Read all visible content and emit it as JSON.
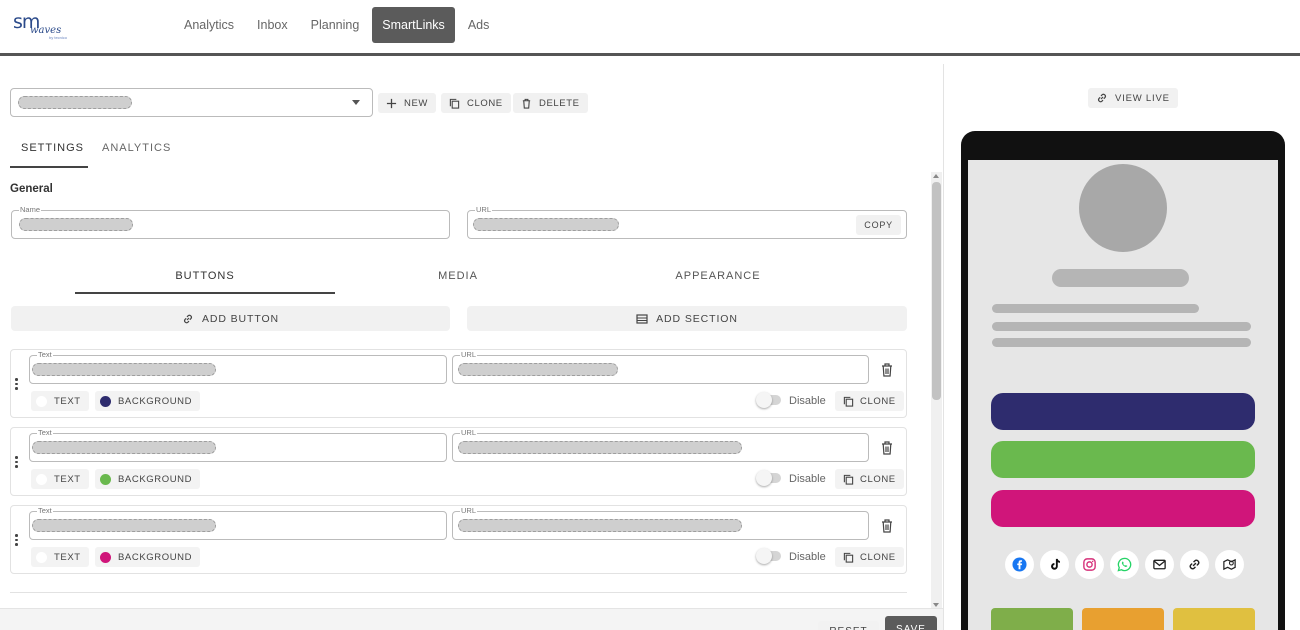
{
  "app": {
    "logo": {
      "primary": "sm",
      "secondary": "waves",
      "tagline": "by tecnico"
    },
    "nav": [
      {
        "label": "Analytics",
        "active": false
      },
      {
        "label": "Inbox",
        "active": false
      },
      {
        "label": "Planning",
        "active": false
      },
      {
        "label": "SmartLinks",
        "active": true
      },
      {
        "label": "Ads",
        "active": false
      }
    ]
  },
  "toolbar": {
    "new_label": "NEW",
    "clone_label": "CLONE",
    "delete_label": "DELETE"
  },
  "tabs": [
    {
      "label": "SETTINGS",
      "active": true
    },
    {
      "label": "ANALYTICS",
      "active": false
    }
  ],
  "general": {
    "title": "General",
    "name_label": "Name",
    "url_label": "URL",
    "copy_label": "COPY"
  },
  "subtabs": [
    {
      "label": "BUTTONS",
      "active": true
    },
    {
      "label": "MEDIA",
      "active": false
    },
    {
      "label": "APPEARANCE",
      "active": false
    }
  ],
  "actions": {
    "add_button_label": "ADD BUTTON",
    "add_section_label": "ADD SECTION"
  },
  "buttons": [
    {
      "text_label": "Text",
      "url_label": "URL",
      "text_chip": "TEXT",
      "bg_chip": "BACKGROUND",
      "bg_color": "#2e2c6e",
      "disable_label": "Disable",
      "clone_label": "CLONE"
    },
    {
      "text_label": "Text",
      "url_label": "URL",
      "text_chip": "TEXT",
      "bg_chip": "BACKGROUND",
      "bg_color": "#6ab94e",
      "disable_label": "Disable",
      "clone_label": "CLONE"
    },
    {
      "text_label": "Text",
      "url_label": "URL",
      "text_chip": "TEXT",
      "bg_chip": "BACKGROUND",
      "bg_color": "#d0157a",
      "disable_label": "Disable",
      "clone_label": "CLONE"
    }
  ],
  "footer": {
    "reset_label": "RESET",
    "save_label": "SAVE"
  },
  "preview": {
    "view_live_label": "VIEW LIVE",
    "button_colors": [
      "#2e2c6e",
      "#6ab94e",
      "#d0157a"
    ],
    "socials": [
      "facebook-icon",
      "tiktok-icon",
      "instagram-icon",
      "whatsapp-icon",
      "email-icon",
      "link-icon",
      "map-icon"
    ],
    "thumbnail_colors": [
      "#7fae4a",
      "#e8a030",
      "#e0c040"
    ]
  }
}
